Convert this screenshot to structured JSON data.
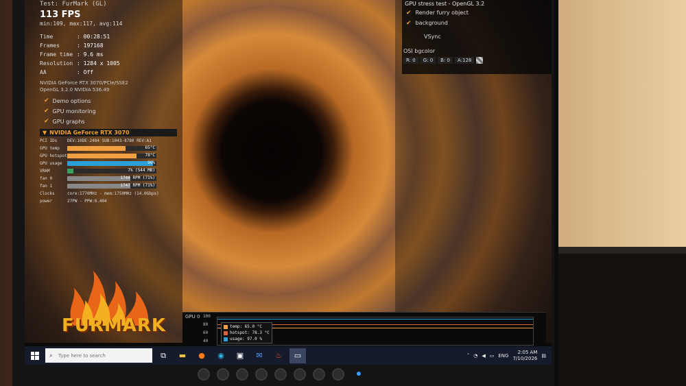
{
  "info": {
    "title": "Test: FurMark (GL)",
    "fps": "113 FPS",
    "fps_range": "min:109, max:117, avg:114",
    "stats": [
      {
        "k": "Time",
        "v": ": 00:28:51"
      },
      {
        "k": "Frames",
        "v": ": 197168"
      },
      {
        "k": "Frame time",
        "v": ": 9.6 ms"
      },
      {
        "k": "Resolution",
        "v": ": 1284 x 1005"
      },
      {
        "k": "AA",
        "v": ": Off"
      }
    ],
    "gpu_name": "NVIDIA GeForce RTX 3070/PCIe/SSE2",
    "opengl": "OpenGL 3.2.0 NVIDIA 536.49",
    "options": [
      "Demo options",
      "GPU monitoring",
      "GPU graphs"
    ]
  },
  "gpu_panel": {
    "header": "NVIDIA GeForce RTX 3070",
    "pci": "PCI IDs",
    "pci_val": "DEV:10DE-2484 SUB:1043-8780 REV:A1",
    "rows": [
      {
        "k": "GPU temp",
        "text": "65°C",
        "pct": 0.65,
        "color": "#f0a040"
      },
      {
        "k": "GPU hotspot",
        "text": "78°C",
        "pct": 0.78,
        "color": "#f0a040"
      },
      {
        "k": "GPU usage",
        "text": "96%",
        "pct": 0.96,
        "color": "#2a9fd8"
      },
      {
        "k": "VRAM",
        "text": "7% (544 MB)",
        "pct": 0.07,
        "color": "#3aa060"
      },
      {
        "k": "fan 0",
        "text": "1744 RPM (71%)",
        "pct": 0.71,
        "color": "#888888"
      },
      {
        "k": "fan 1",
        "text": "1747 RPM (71%)",
        "pct": 0.71,
        "color": "#888888"
      }
    ],
    "clocks_k": "Clocks",
    "clocks_v": "core:1770MHz - mem:1750MHz (14.0Gbps)",
    "power_k": "power",
    "power_v": "27PW - PPW:0.404"
  },
  "logo": "FURMARK",
  "settings": {
    "title": "GPU stress test - OpenGL 3.2",
    "items": [
      "Render furry object",
      "background"
    ],
    "vsync": "VSync",
    "osd": "OSI bgcolor",
    "bgcolor": [
      "R: 0",
      "G: 0",
      "B: 0",
      "A:128"
    ]
  },
  "graph": {
    "label": "GPU 0",
    "yticks": [
      "100",
      "80",
      "60",
      "40"
    ],
    "legend": [
      {
        "label": "temp: 65.0 °C",
        "color": "#f0a040"
      },
      {
        "label": "hotspot: 78.3 °C",
        "color": "#e06030"
      },
      {
        "label": "usage: 97.0 %",
        "color": "#2a9fd8"
      }
    ]
  },
  "taskbar": {
    "search_placeholder": "Type here to search",
    "lang": "ENG",
    "time": "2:05 AM",
    "date": "7/10/2026"
  }
}
